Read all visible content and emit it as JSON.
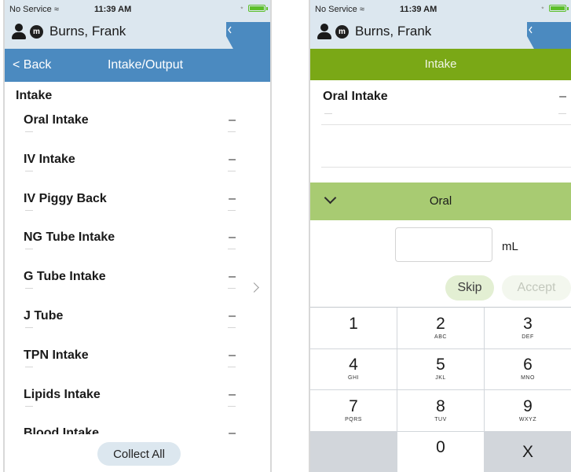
{
  "status": {
    "carrier": "No Service",
    "time": "11:39 AM"
  },
  "patient": {
    "badge": "m",
    "name": "Burns, Frank"
  },
  "left_screen": {
    "back_label": "< Back",
    "title": "Intake/Output",
    "section_title": "Intake",
    "items": [
      {
        "label": "Oral Intake",
        "value": "–"
      },
      {
        "label": "IV Intake",
        "value": "–"
      },
      {
        "label": "IV Piggy Back",
        "value": "–"
      },
      {
        "label": "NG Tube Intake",
        "value": "–"
      },
      {
        "label": "G Tube Intake",
        "value": "–"
      },
      {
        "label": "J Tube",
        "value": "–"
      },
      {
        "label": "TPN Intake",
        "value": "–"
      },
      {
        "label": "Lipids Intake",
        "value": "–"
      },
      {
        "label": "Blood Intake",
        "value": "–"
      }
    ],
    "collect_all_label": "Collect All"
  },
  "right_screen": {
    "header_title": "Intake",
    "item_title": "Oral Intake",
    "item_value": "–",
    "oral_section_label": "Oral",
    "input_value": "",
    "unit": "mL",
    "skip_label": "Skip",
    "accept_label": "Accept",
    "keypad": [
      {
        "digit": "1",
        "letters": ""
      },
      {
        "digit": "2",
        "letters": "ABC"
      },
      {
        "digit": "3",
        "letters": "DEF"
      },
      {
        "digit": "4",
        "letters": "GHI"
      },
      {
        "digit": "5",
        "letters": "JKL"
      },
      {
        "digit": "6",
        "letters": "MNO"
      },
      {
        "digit": "7",
        "letters": "PQRS"
      },
      {
        "digit": "8",
        "letters": "TUV"
      },
      {
        "digit": "9",
        "letters": "WXYZ"
      },
      {
        "digit": "",
        "letters": ""
      },
      {
        "digit": "0",
        "letters": ""
      },
      {
        "digit": "X",
        "letters": ""
      }
    ]
  },
  "colors": {
    "nav_blue": "#4b8ac0",
    "patient_bar": "#dce7ef",
    "intake_green": "#7aa816",
    "oral_green": "#a8cb72"
  }
}
